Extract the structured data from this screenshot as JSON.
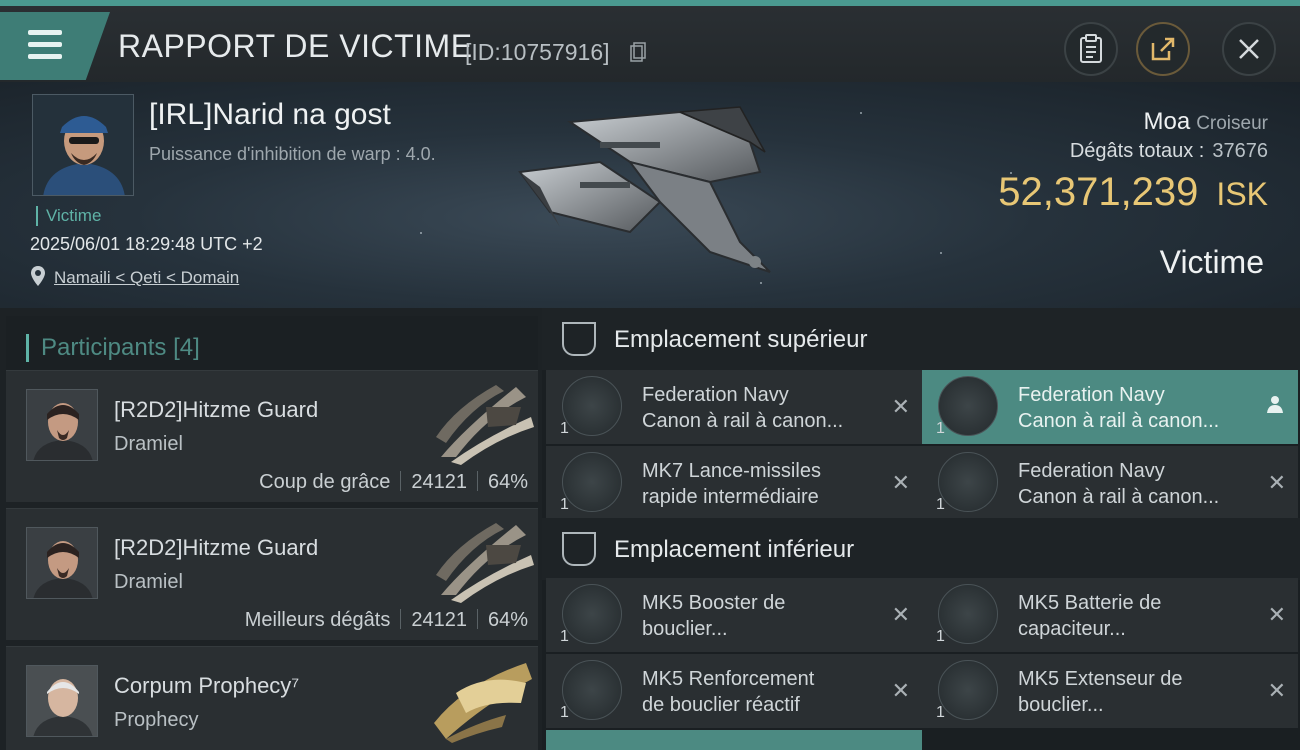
{
  "header": {
    "title": "RAPPORT DE VICTIME",
    "report_id": "[ID:10757916]"
  },
  "victim": {
    "name": "[IRL]Narid na gost",
    "detail": "Puissance d'inhibition de warp : 4.0.",
    "tag": "Victime",
    "datetime": "2025/06/01 18:29:48 UTC +2",
    "location": "Namaili < Qeti < Domain",
    "ship_name": "Moa",
    "ship_class": "Croiseur",
    "damage_label": "Dégâts totaux :",
    "damage_value": "37676",
    "isk_value": "52,371,239",
    "isk_unit": "ISK",
    "role_label": "Victime"
  },
  "participants": {
    "label": "Participants",
    "count": "[4]",
    "rows": [
      {
        "name": "[R2D2]Hitzme Guard",
        "ship": "Dramiel",
        "label": "Coup de grâce",
        "damage": "24121",
        "percent": "64%"
      },
      {
        "name": "[R2D2]Hitzme Guard",
        "ship": "Dramiel",
        "label": "Meilleurs dégâts",
        "damage": "24121",
        "percent": "64%"
      },
      {
        "name": "Corpum Prophecy⁷",
        "ship": "Prophecy"
      }
    ]
  },
  "slots": {
    "high": {
      "label": "Emplacement supérieur",
      "items": [
        {
          "line1": "Federation Navy",
          "line2": "Canon à rail à canon...",
          "qty": "1"
        },
        {
          "line1": "Federation Navy",
          "line2": "Canon à rail à canon...",
          "qty": "1"
        },
        {
          "line1": "MK7 Lance-missiles",
          "line2": "rapide intermédiaire",
          "qty": "1"
        },
        {
          "line1": "Federation Navy",
          "line2": "Canon à rail à canon...",
          "qty": "1"
        }
      ]
    },
    "low": {
      "label": "Emplacement inférieur",
      "items": [
        {
          "line1": "MK5 Booster de",
          "line2": "bouclier...",
          "qty": "1"
        },
        {
          "line1": "MK5 Batterie de",
          "line2": "capaciteur...",
          "qty": "1"
        },
        {
          "line1": "MK5 Renforcement",
          "line2": "de bouclier réactif",
          "qty": "1"
        },
        {
          "line1": "MK5 Extenseur de",
          "line2": "bouclier...",
          "qty": "1"
        }
      ]
    },
    "close_glyph": "✕"
  },
  "colors": {
    "accent": "#4e8a83",
    "isk": "#e8c775",
    "selected": "#4c8a82"
  }
}
